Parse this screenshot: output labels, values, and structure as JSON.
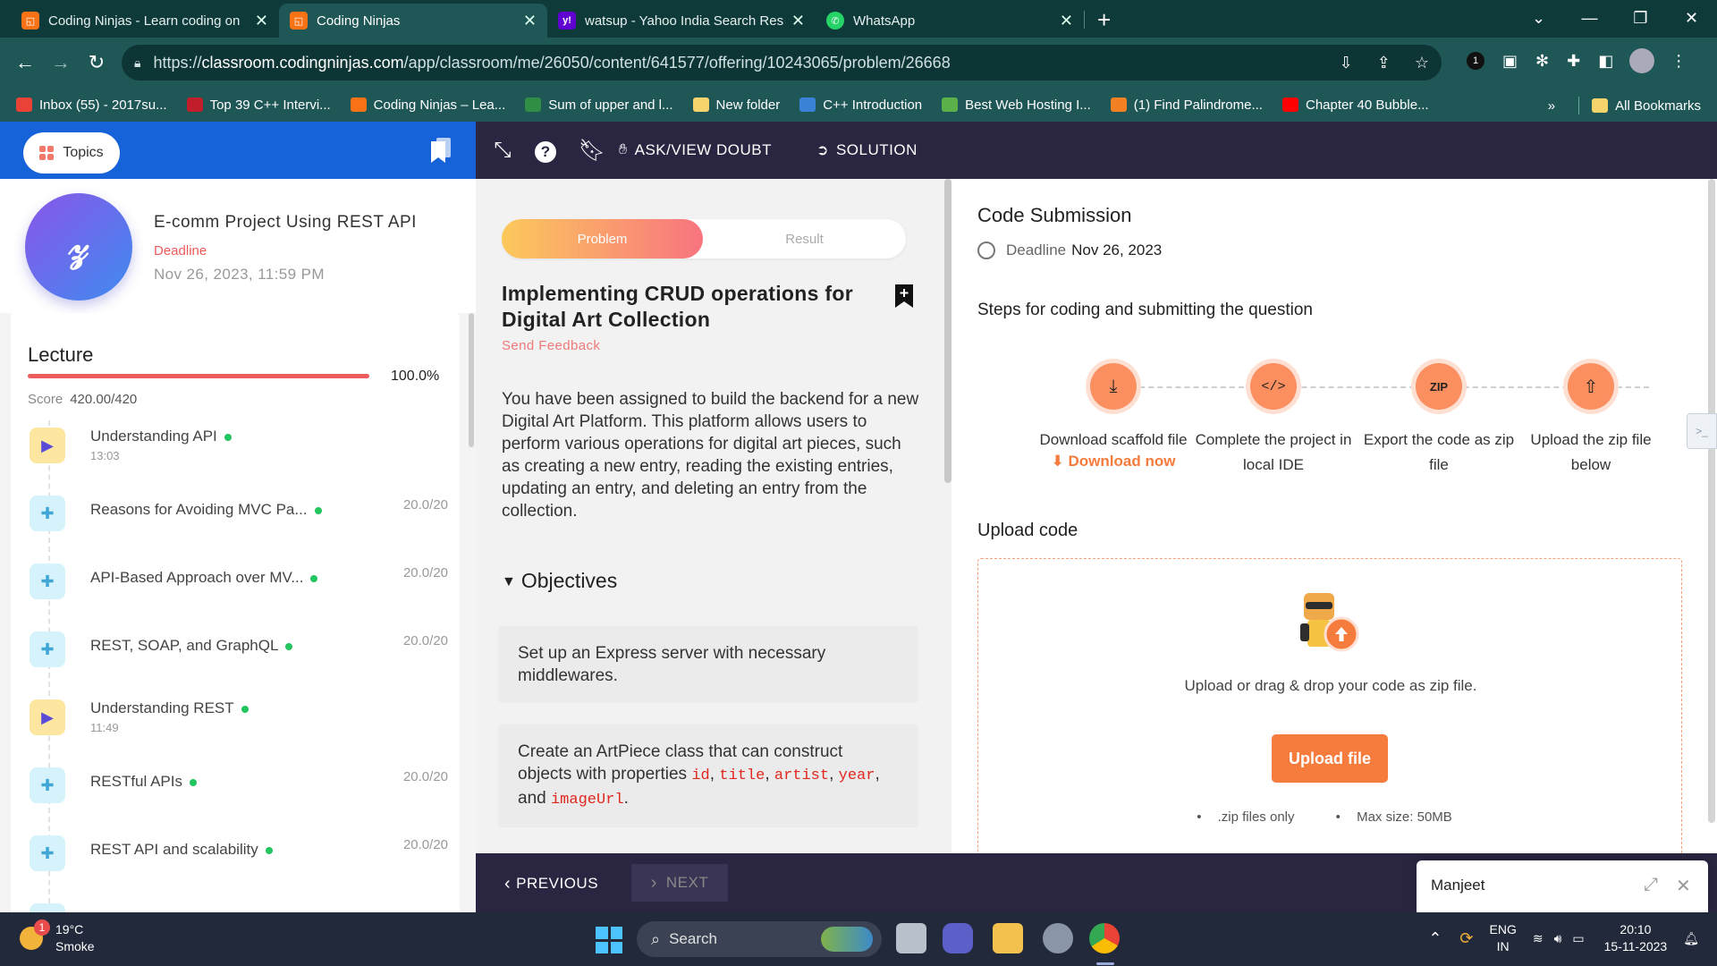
{
  "browser": {
    "tabs": [
      {
        "title": "Coding Ninjas - Learn coding on",
        "icon": "coding-ninjas",
        "color": "#f97316"
      },
      {
        "title": "Coding Ninjas",
        "icon": "coding-ninjas",
        "color": "#f97316"
      },
      {
        "title": "watsup - Yahoo India Search Res",
        "icon": "yahoo",
        "color": "#6001d2"
      },
      {
        "title": "WhatsApp",
        "icon": "whatsapp",
        "color": "#25d366"
      }
    ],
    "url_prefix": "https://",
    "url_host": "classroom.codingninjas.com",
    "url_path": "/app/classroom/me/26050/content/641577/offering/10243065/problem/26668",
    "bookmarks": [
      "Inbox (55) - 2017su...",
      "Top 39 C++ Intervi...",
      "Coding Ninjas – Lea...",
      "Sum of upper and l...",
      "New folder",
      "C++ Introduction",
      "Best Web Hosting I...",
      "(1) Find Palindrome...",
      "Chapter 40 Bubble..."
    ],
    "all_bookmarks": "All Bookmarks",
    "more_bookmarks": "»",
    "ext_badge": "1"
  },
  "header": {
    "topics_label": "Topics",
    "ask_label": "ASK/VIEW DOUBT",
    "solution_label": "SOLUTION"
  },
  "course": {
    "title": "E-comm Project Using REST API",
    "deadline_label": "Deadline",
    "deadline_date": "Nov 26, 2023, 11:59 PM"
  },
  "lecture": {
    "title": "Lecture",
    "progress_pct_label": "100.0%",
    "progress": 1.0,
    "score_label": "Score",
    "score_value": "420.00/420",
    "items": [
      {
        "name": "Understanding API",
        "type": "video",
        "duration": "13:03",
        "points": ""
      },
      {
        "name": "Reasons for Avoiding MVC Pa...",
        "type": "problem",
        "duration": "",
        "points": "20.0/20"
      },
      {
        "name": "API-Based Approach over MV...",
        "type": "problem",
        "duration": "",
        "points": "20.0/20"
      },
      {
        "name": "REST, SOAP, and GraphQL",
        "type": "problem",
        "duration": "",
        "points": "20.0/20"
      },
      {
        "name": "Understanding REST",
        "type": "video",
        "duration": "11:49",
        "points": ""
      },
      {
        "name": "RESTful APIs",
        "type": "problem",
        "duration": "",
        "points": "20.0/20"
      },
      {
        "name": "REST API and scalability",
        "type": "problem",
        "duration": "",
        "points": "20.0/20"
      }
    ]
  },
  "problem": {
    "tab_problem": "Problem",
    "tab_result": "Result",
    "title": "Implementing CRUD operations for Digital Art Collection",
    "send_feedback": "Send Feedback",
    "description": "You have been assigned to build the backend for a new Digital Art Platform. This platform allows users to perform various operations for digital art pieces, such as creating a new entry, reading the existing entries, updating an entry, and deleting an entry from the collection.",
    "objectives_label": "Objectives",
    "objective_1": "Set up an Express server with necessary middlewares.",
    "objective_2_pre": "Create an ArtPiece class that can construct objects with properties ",
    "objective_2_props": [
      "id",
      "title",
      "artist",
      "year",
      "imageUrl"
    ],
    "objective_2_and": ", and",
    "objective_2_end": "."
  },
  "submission": {
    "title": "Code Submission",
    "deadline_label": "Deadline",
    "deadline_date": "Nov 26, 2023",
    "steps_title": "Steps for coding and submitting the question",
    "steps": [
      {
        "label": "Download scaffold file",
        "icon": "download-icon"
      },
      {
        "label": "Complete the project in local IDE",
        "icon": "code-icon"
      },
      {
        "label": "Export the code as zip file",
        "icon": "zip-icon"
      },
      {
        "label": "Upload the zip file below",
        "icon": "upload-icon"
      }
    ],
    "download_now": "Download now",
    "upload_title": "Upload code",
    "dropzone_text": "Upload or drag & drop your code as zip file.",
    "upload_button": "Upload file",
    "note_1": ".zip files only",
    "note_2": "Max size: 50MB",
    "accent": "#f57c3c"
  },
  "footer": {
    "previous": "PREVIOUS",
    "next": "NEXT"
  },
  "chat": {
    "name": "Manjeet"
  },
  "taskbar": {
    "temp": "19°C",
    "weather": "Smoke",
    "weather_badge": "1",
    "search": "Search",
    "lang_1": "ENG",
    "lang_2": "IN",
    "time": "20:10",
    "date": "15-11-2023"
  }
}
